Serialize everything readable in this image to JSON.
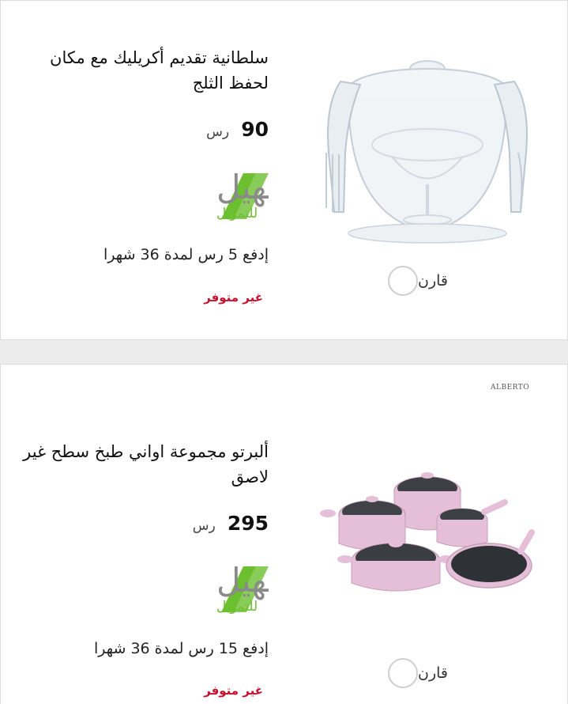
{
  "products": [
    {
      "title": "سلطانية تقديم أكريليك مع مكان لحفظ الثلج",
      "price": "90",
      "currency": "رس",
      "financing_logo": "تسهيل",
      "financing_logo_sub": "للتمويل",
      "installment": "إدفع 5 رس  لمدة 36 شهرا",
      "stock_status": "غير متوفر",
      "compare_label": "قارن",
      "image_icon": "acrylic-serving-bowl"
    },
    {
      "title": "ألبرتو مجموعة اواني طبخ سطح غير لاصق",
      "price": "295",
      "currency": "رس",
      "financing_logo": "تسهيل",
      "financing_logo_sub": "للتمويل",
      "installment": "إدفع 15 رس  لمدة 36 شهرا",
      "stock_status": "غير متوفر",
      "compare_label": "قارن",
      "brand": "ALBERTO",
      "image_icon": "pink-cookware-set"
    }
  ],
  "colors": {
    "stock_red": "#c8102e",
    "tasheel_green": "#6cbf2f",
    "tasheel_gray": "#8a8a8a",
    "cookware_pink": "#e4bfd7"
  }
}
